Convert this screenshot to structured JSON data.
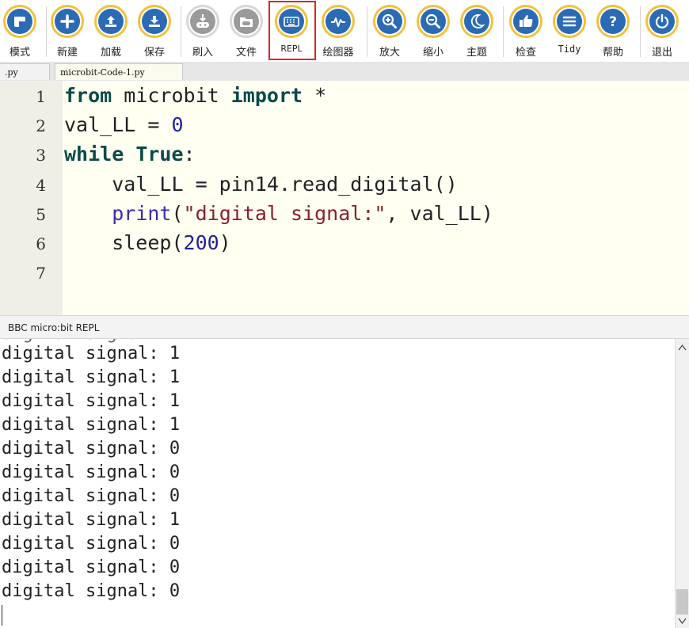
{
  "toolbar": {
    "buttons": [
      {
        "label": "模式",
        "icon": "mode-icon"
      },
      {
        "label": "新建",
        "icon": "plus-icon"
      },
      {
        "label": "加载",
        "icon": "upload-icon"
      },
      {
        "label": "保存",
        "icon": "download-icon"
      },
      {
        "label": "刷入",
        "icon": "flash-icon"
      },
      {
        "label": "文件",
        "icon": "files-icon"
      },
      {
        "label": "REPL",
        "icon": "keyboard-icon"
      },
      {
        "label": "绘图器",
        "icon": "plotter-icon"
      },
      {
        "label": "放大",
        "icon": "zoom-in-icon"
      },
      {
        "label": "缩小",
        "icon": "zoom-out-icon"
      },
      {
        "label": "主题",
        "icon": "moon-icon"
      },
      {
        "label": "检查",
        "icon": "thumbs-up-icon"
      },
      {
        "label": "Tidy",
        "icon": "tidy-icon"
      },
      {
        "label": "帮助",
        "icon": "help-icon"
      },
      {
        "label": "退出",
        "icon": "power-icon"
      }
    ]
  },
  "tabs": [
    ".py",
    "microbit-Code-1.py"
  ],
  "editor": {
    "line_numbers": [
      "1",
      "2",
      "3",
      "4",
      "5",
      "6",
      "7"
    ],
    "lines": [
      "from microbit import *",
      "val_LL = 0",
      "while True:",
      "    val_LL = pin14.read_digital()",
      "    print(\"digital signal:\", val_LL)",
      "    sleep(200)",
      ""
    ]
  },
  "repl": {
    "title": "BBC micro:bit REPL",
    "output": [
      "digital signal: 1",
      "digital signal: 1",
      "digital signal: 1",
      "digital signal: 1",
      "digital signal: 0",
      "digital signal: 0",
      "digital signal: 0",
      "digital signal: 1",
      "digital signal: 0",
      "digital signal: 0",
      "digital signal: 0"
    ]
  },
  "colors": {
    "accent": "#f3c23c",
    "icon": "#2b6bb5",
    "highlight": "#e02626"
  }
}
